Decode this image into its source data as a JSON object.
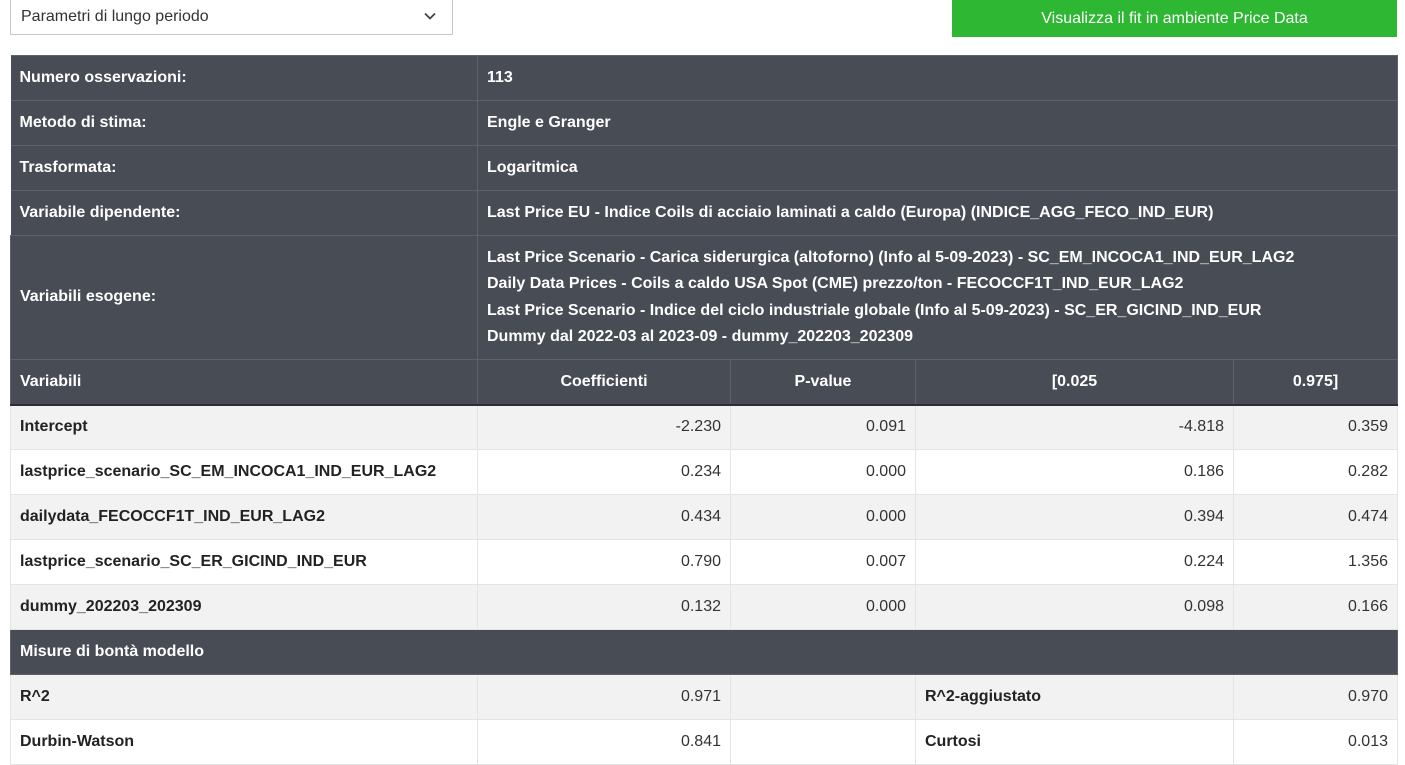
{
  "toolbar": {
    "select_value": "Parametri di lungo periodo",
    "visualize_label": "Visualizza il fit in ambiente Price Data"
  },
  "info": [
    {
      "label": "Numero osservazioni:",
      "value": "113"
    },
    {
      "label": "Metodo di stima:",
      "value": "Engle e Granger"
    },
    {
      "label": "Trasformata:",
      "value": "Logaritmica"
    },
    {
      "label": "Variabile dipendente:",
      "value": "Last Price EU - Indice Coils di acciaio laminati a caldo (Europa) (INDICE_AGG_FECO_IND_EUR)"
    }
  ],
  "exog": {
    "label": "Variabili esogene:",
    "lines": [
      "Last Price Scenario - Carica siderurgica (altoforno) (Info al 5-09-2023) - SC_EM_INCOCA1_IND_EUR_LAG2",
      "Daily Data Prices - Coils a caldo USA Spot (CME) prezzo/ton - FECOCCF1T_IND_EUR_LAG2",
      "Last Price Scenario - Indice del ciclo industriale globale (Info al 5-09-2023) - SC_ER_GICIND_IND_EUR",
      "Dummy dal 2022-03 al 2023-09 - dummy_202203_202309"
    ]
  },
  "columns": [
    "Variabili",
    "Coefficienti",
    "P-value",
    "[0.025",
    "0.975]"
  ],
  "rows": [
    {
      "name": "Intercept",
      "coef": "-2.230",
      "p": "0.091",
      "lo": "-4.818",
      "hi": "0.359"
    },
    {
      "name": "lastprice_scenario_SC_EM_INCOCA1_IND_EUR_LAG2",
      "coef": "0.234",
      "p": "0.000",
      "lo": "0.186",
      "hi": "0.282"
    },
    {
      "name": "dailydata_FECOCCF1T_IND_EUR_LAG2",
      "coef": "0.434",
      "p": "0.000",
      "lo": "0.394",
      "hi": "0.474"
    },
    {
      "name": "lastprice_scenario_SC_ER_GICIND_IND_EUR",
      "coef": "0.790",
      "p": "0.007",
      "lo": "0.224",
      "hi": "1.356"
    },
    {
      "name": "dummy_202203_202309",
      "coef": "0.132",
      "p": "0.000",
      "lo": "0.098",
      "hi": "0.166"
    }
  ],
  "goodness": {
    "title": "Misure di bontà modello",
    "rows": [
      {
        "label1": "R^2",
        "value1": "0.971",
        "label2": "R^2-aggiustato",
        "value2": "0.970"
      },
      {
        "label1": "Durbin-Watson",
        "value1": "0.841",
        "label2": "Curtosi",
        "value2": "0.013"
      }
    ]
  },
  "colors": {
    "header_bg": "#474c55",
    "button_green": "#2db733"
  }
}
